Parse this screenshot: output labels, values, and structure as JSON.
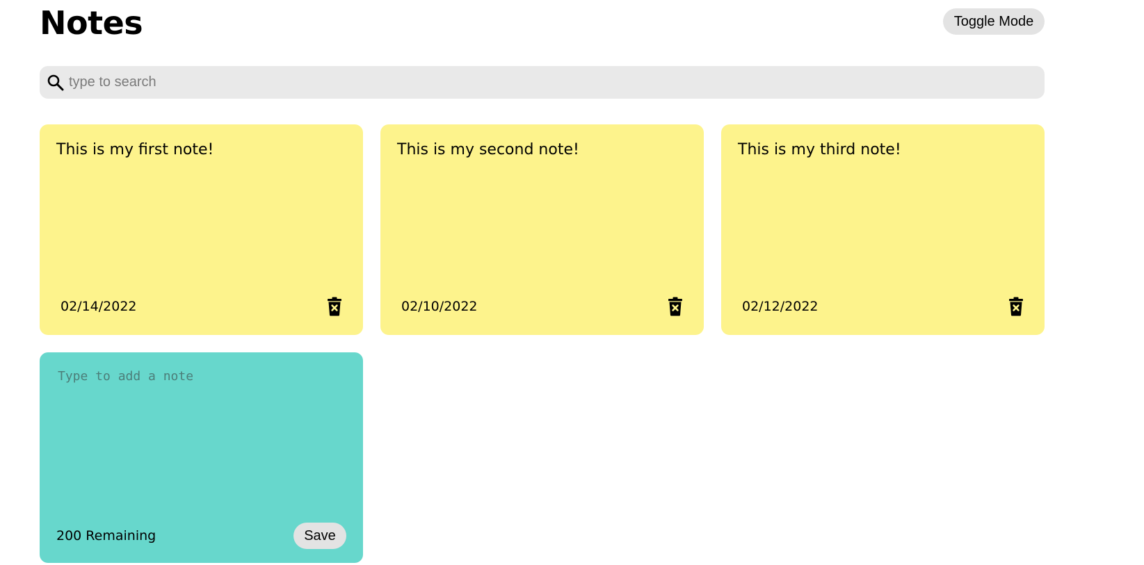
{
  "header": {
    "title": "Notes",
    "toggle_label": "Toggle Mode"
  },
  "search": {
    "placeholder": "type to search",
    "value": "",
    "icon": "search-icon"
  },
  "notes": [
    {
      "text": "This is my first note!",
      "date": "02/14/2022",
      "delete_icon": "delete-icon"
    },
    {
      "text": "This is my second note!",
      "date": "02/10/2022",
      "delete_icon": "delete-icon"
    },
    {
      "text": "This is my third note!",
      "date": "02/12/2022",
      "delete_icon": "delete-icon"
    }
  ],
  "new_note": {
    "placeholder": "Type to add a note",
    "value": "",
    "remaining": "200 Remaining",
    "save_label": "Save"
  },
  "colors": {
    "note_background": "#fdf38c",
    "new_note_background": "#67d7cc",
    "button_background": "#e3e3e3",
    "search_background": "#e9e9e9"
  }
}
